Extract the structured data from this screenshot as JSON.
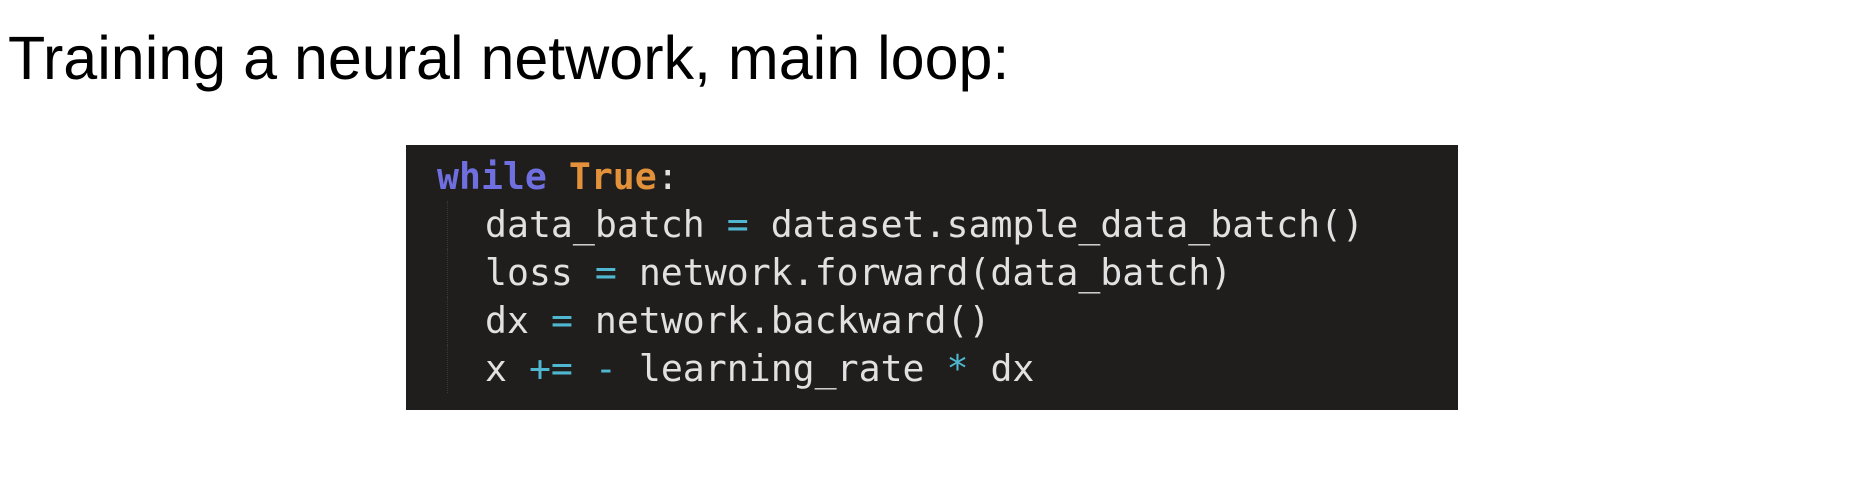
{
  "slide": {
    "title": "Training a neural network, main loop:"
  },
  "code": {
    "line1": {
      "keyword": "while",
      "space": " ",
      "constant": "True",
      "colon": ":"
    },
    "line2": {
      "lhs": "data_batch ",
      "op": "=",
      "rhs": " dataset.sample_data_batch()"
    },
    "line3": {
      "lhs": "loss ",
      "op": "=",
      "rhs": " network.forward(data_batch)"
    },
    "line4": {
      "lhs": "dx ",
      "op": "=",
      "rhs": " network.backward()"
    },
    "line5": {
      "lhs": "x ",
      "op1": "+=",
      "space1": " ",
      "op2": "-",
      "mid": " learning_rate ",
      "op3": "*",
      "rhs": " dx"
    }
  },
  "colors": {
    "code_background": "#1f1e1d",
    "keyword": "#6f6fe0",
    "constant": "#e3913a",
    "operator": "#4fb7cf",
    "text": "#e1e1e1"
  }
}
